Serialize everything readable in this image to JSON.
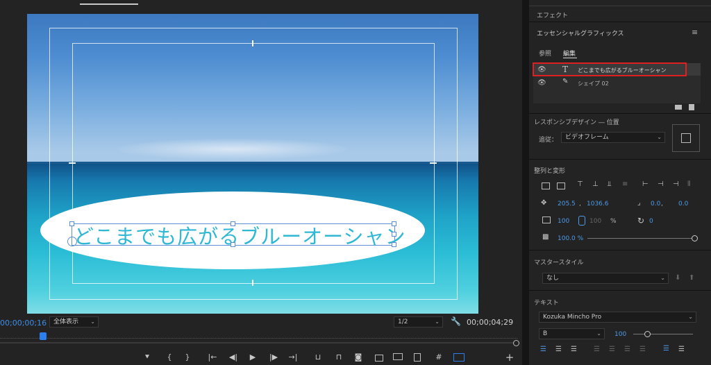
{
  "monitor": {
    "title_text": "どこまでも広がるブルーオーシャン",
    "timecode_current": "00;00;00;16",
    "zoom_select": "全体表示",
    "resolution_select": "1/2",
    "timecode_duration": "00;00;04;29",
    "controls": {
      "marker": "⯆",
      "mark_in": "{",
      "mark_out": "}",
      "go_to_in": "|←",
      "step_back": "◀|",
      "play": "▶",
      "step_forward": "|▶",
      "go_to_out": "→|",
      "lift": "⊔",
      "extract": "⊓",
      "export_frame": "◙",
      "add": "+"
    }
  },
  "panel": {
    "effects_tab": "エフェクト",
    "essential_graphics_title": "エッセンシャルグラフィックス",
    "menu_icon": "≡",
    "tabs": [
      "参照",
      "編集"
    ],
    "layers": [
      {
        "icon": "T",
        "name": "どこまでも広がるブルーオーシャン"
      },
      {
        "icon": "✎",
        "name": "シェイプ 02"
      }
    ],
    "responsive_title": "レスポンシブデザイン ― 位置",
    "pin_label": "追従：",
    "pin_value": "ビデオフレーム",
    "align_title": "整列と変形",
    "position_x": "205.5",
    "position_sep": ",",
    "position_y": "1036.6",
    "anchor_x": "0.0",
    "anchor_sep": ",",
    "anchor_y": "0.0",
    "scale_w": "100",
    "scale_h": "100",
    "scale_unit": "%",
    "rotation": "0",
    "opacity": "100.0 %",
    "master_style_title": "マスタースタイル",
    "master_style_value": "なし",
    "text_title": "テキスト",
    "font_name": "Kozuka Mincho Pro",
    "font_style": "B",
    "font_size": "100"
  }
}
